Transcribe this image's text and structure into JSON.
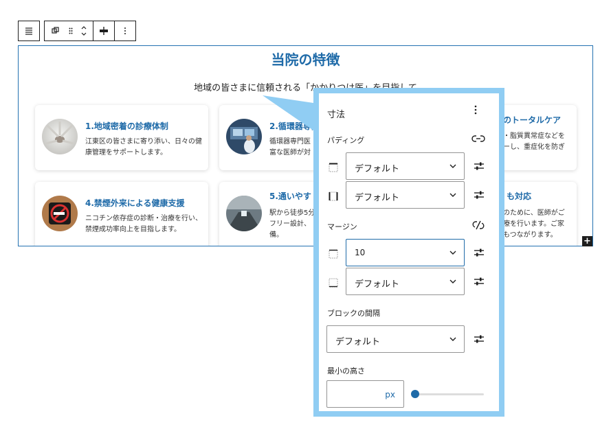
{
  "toolbar": {
    "icons": [
      "align-lines-icon",
      "group-icon",
      "drag-handle-icon",
      "move-up-down-icon",
      "justify-icon",
      "more-vertical-icon"
    ]
  },
  "block": {
    "title": "当院の特徴",
    "subtitle": "地域の皆さまに信頼される「かかりつけ医」を目指して",
    "cards": [
      {
        "title": "1.地域密着の診療体制",
        "desc": "江東区の皆さまに寄り添い、日々の健康管理をサポートします。"
      },
      {
        "title": "2.循環器専門",
        "desc": "循環器専門医\n富な医師が対"
      },
      {
        "title": "のトータルケア",
        "desc": "・脂質異常症などを\nーし、重症化を防ぎ"
      },
      {
        "title": "4.禁煙外来による健康支援",
        "desc": "ニコチン依存症の診断・治療を行い、禁煙成功率向上を目指します。"
      },
      {
        "title": "5.通いやす",
        "desc": "駅から徒歩5分\nフリー設計、\n備。"
      },
      {
        "title": "も対応",
        "desc": "のために、医師がご\n療を行います。ご家\nもつながります。"
      }
    ]
  },
  "panel": {
    "title": "寸法",
    "padding_label": "パディング",
    "margin_label": "マージン",
    "block_gap_label": "ブロックの間隔",
    "min_height_label": "最小の高さ",
    "padding_top_value": "デフォルト",
    "padding_side_value": "デフォルト",
    "margin_top_value": "10",
    "margin_bottom_value": "デフォルト",
    "block_gap_value": "デフォルト",
    "min_height_unit": "px",
    "min_height_value": "",
    "slider_level": 0
  },
  "colors": {
    "accent": "#1e6aa8",
    "callout": "#90cdf3"
  }
}
